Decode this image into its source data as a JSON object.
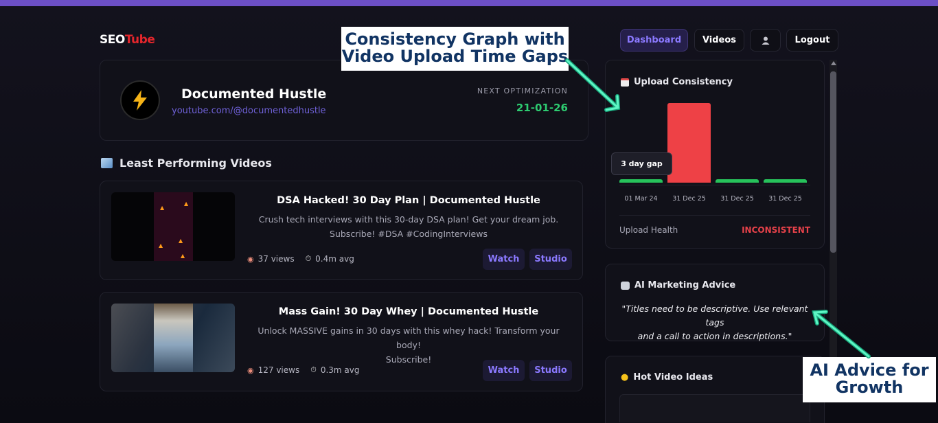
{
  "brand": {
    "prefix": "SEO",
    "suffix": "Tube"
  },
  "nav": {
    "dashboard": "Dashboard",
    "videos": "Videos",
    "logout": "Logout"
  },
  "channel": {
    "name": "Documented Hustle",
    "url": "youtube.com/@documentedhustle",
    "next_label": "NEXT OPTIMIZATION",
    "next_date": "21-01-26"
  },
  "least": {
    "title": "Least Performing Videos",
    "videos": [
      {
        "title": "DSA Hacked! 30 Day Plan | Documented Hustle",
        "desc1": "Crush tech interviews with this 30-day DSA plan! Get your dream job.",
        "desc2": "Subscribe! #DSA #CodingInterviews",
        "views": "37 views",
        "avg": "0.4m avg",
        "watch": "Watch",
        "studio": "Studio"
      },
      {
        "title": "Mass Gain! 30 Day Whey | Documented Hustle",
        "desc1": "Unlock MASSIVE gains in 30 days with this whey hack! Transform your body!",
        "desc2": "Subscribe!",
        "views": "127 views",
        "avg": "0.3m avg",
        "watch": "Watch",
        "studio": "Studio"
      }
    ]
  },
  "consistency": {
    "title": "Upload Consistency",
    "tooltip": "3 day gap",
    "health_label": "Upload Health",
    "health_value": "INCONSISTENT",
    "health_color": "#e8424a"
  },
  "chart_data": {
    "type": "bar",
    "title": "Upload Consistency",
    "categories": [
      "01 Mar 24",
      "31 Dec 25",
      "31 Dec 25",
      "31 Dec 25"
    ],
    "values": [
      3,
      300,
      3,
      3
    ],
    "colors": [
      "#27c25b",
      "#ee4146",
      "#27c25b",
      "#27c25b"
    ],
    "ylim": [
      0,
      300
    ],
    "grid": false
  },
  "advice": {
    "title": "AI Marketing Advice",
    "text1": "\"Titles need to be descriptive. Use relevant tags",
    "text2": "and a call to action in descriptions.\""
  },
  "ideas": {
    "title": "Hot Video Ideas"
  },
  "callouts": {
    "graph1": "Consistency Graph with",
    "graph2": "Video Upload Time Gaps",
    "ai1": "AI Advice for",
    "ai2": "Growth"
  }
}
